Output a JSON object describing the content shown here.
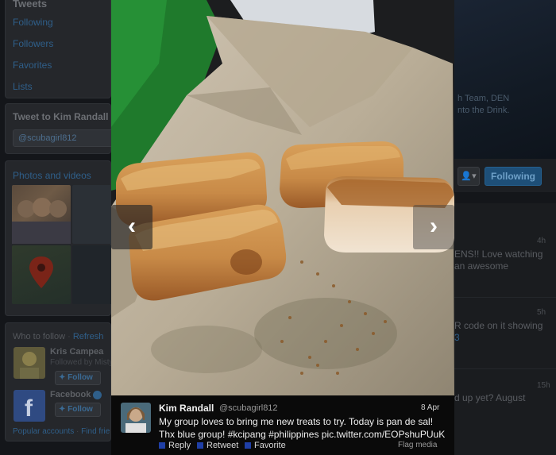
{
  "background": {
    "left_nav": {
      "title": "Tweets",
      "items": [
        {
          "label": "Following"
        },
        {
          "label": "Followers"
        },
        {
          "label": "Favorites"
        },
        {
          "label": "Lists"
        }
      ]
    },
    "tweet_to": {
      "title": "Tweet to Kim Randall",
      "input_value": "@scubagirl812"
    },
    "photos": {
      "title": "Photos and videos"
    },
    "who_to_follow": {
      "title": "Who to follow",
      "separator": " · ",
      "refresh": "Refresh",
      "suggestions": [
        {
          "name": "Kris Campea",
          "sub": "Followed by Misty",
          "follow_label": "Follow"
        },
        {
          "name": "Facebook",
          "follow_label": "Follow"
        }
      ],
      "footer_popular": "Popular accounts",
      "footer_separator": " · ",
      "footer_find": "Find frie"
    },
    "header": {
      "text_line1": "h Team, DEN",
      "text_line2": "nto the Drink."
    },
    "profile_actions": {
      "user_menu": "▾",
      "following_label": "Following"
    },
    "timeline": {
      "items": [
        {
          "time": "4h",
          "line1": "ENS!! Love watching",
          "line2": "an awesome"
        },
        {
          "time": "5h",
          "line1": "R code on it showing",
          "line2": "3"
        },
        {
          "time": "15h",
          "line1": "d up yet? August"
        }
      ]
    }
  },
  "media": {
    "prev_label": "‹",
    "next_label": "›",
    "tweet": {
      "name": "Kim Randall",
      "handle": "@scubagirl812",
      "date": "8 Apr",
      "text": "My group loves to bring me new treats to try. Today is pan de sal! Thx blue group! #kcipang #philippines pic.twitter.com/EOPshuPUuK",
      "actions": {
        "reply": "Reply",
        "retweet": "Retweet",
        "favorite": "Favorite",
        "flag": "Flag media"
      }
    }
  },
  "colors": {
    "accent": "#1f3fa6",
    "link": "#2f5f8a",
    "following_button": "#1e4f78"
  }
}
